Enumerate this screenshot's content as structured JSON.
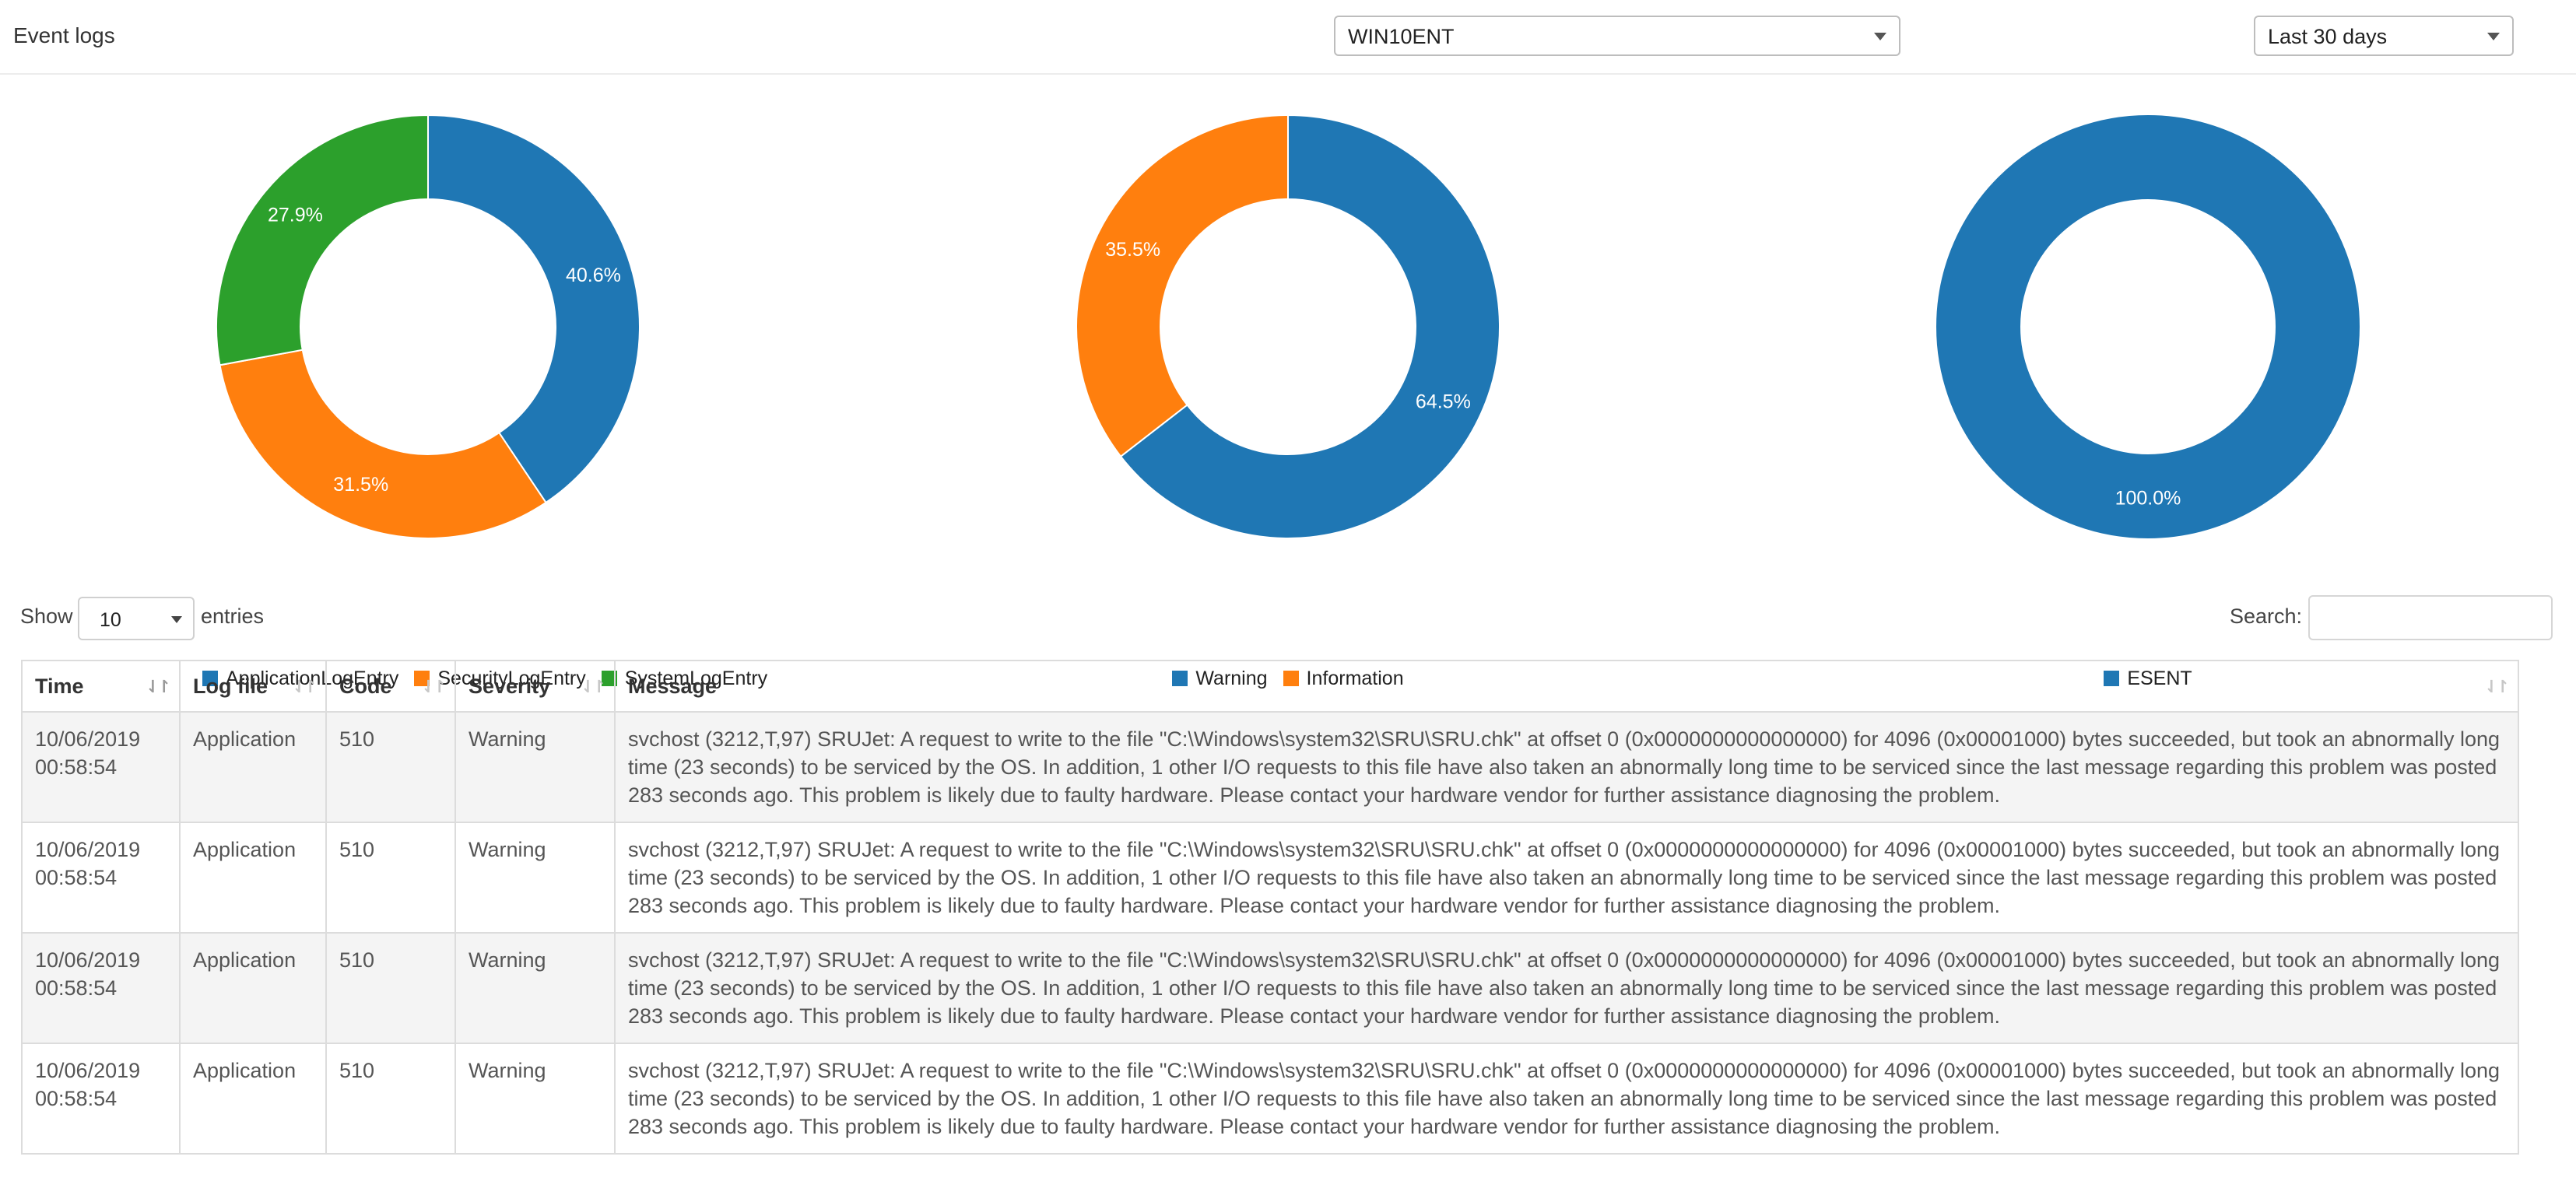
{
  "header": {
    "title": "Event logs",
    "host_select": "WIN10ENT",
    "range_select": "Last 30 days"
  },
  "colors": {
    "blue": "#1f77b4",
    "orange": "#ff7f0e",
    "green": "#2ca02c"
  },
  "chart_data": [
    {
      "type": "pie",
      "donut": true,
      "slices": [
        {
          "name": "ApplicationLogEntry",
          "value": 40.6,
          "label": "40.6%",
          "color": "#1f77b4"
        },
        {
          "name": "SecurityLogEntry",
          "value": 31.5,
          "label": "31.5%",
          "color": "#ff7f0e"
        },
        {
          "name": "SystemLogEntry",
          "value": 27.9,
          "label": "27.9%",
          "color": "#2ca02c"
        }
      ],
      "legend_position": "bottom"
    },
    {
      "type": "pie",
      "donut": true,
      "slices": [
        {
          "name": "Warning",
          "value": 64.5,
          "label": "64.5%",
          "color": "#1f77b4"
        },
        {
          "name": "Information",
          "value": 35.5,
          "label": "35.5%",
          "color": "#ff7f0e"
        }
      ],
      "legend_position": "bottom"
    },
    {
      "type": "pie",
      "donut": true,
      "slices": [
        {
          "name": "ESENT",
          "value": 100.0,
          "label": "100.0%",
          "color": "#1f77b4"
        }
      ],
      "legend_position": "bottom"
    }
  ],
  "table_controls": {
    "show_label": "Show",
    "length_value": "10",
    "entries_label": "entries",
    "search_label": "Search:",
    "search_value": ""
  },
  "table": {
    "columns": [
      "Time",
      "Log file",
      "Code",
      "Severity",
      "Message"
    ],
    "rows": [
      {
        "time_date": "10/06/2019",
        "time_clock": "00:58:54",
        "log_file": "Application",
        "code": "510",
        "severity": "Warning",
        "message": "svchost (3212,T,97) SRUJet: A request to write to the file \"C:\\Windows\\system32\\SRU\\SRU.chk\" at offset 0 (0x0000000000000000) for 4096 (0x00001000) bytes succeeded, but took an abnormally long time (23 seconds) to be serviced by the OS. In addition, 1 other I/O requests to this file have also taken an abnormally long time to be serviced since the last message regarding this problem was posted 283 seconds ago. This problem is likely due to faulty hardware. Please contact your hardware vendor for further assistance diagnosing the problem."
      },
      {
        "time_date": "10/06/2019",
        "time_clock": "00:58:54",
        "log_file": "Application",
        "code": "510",
        "severity": "Warning",
        "message": "svchost (3212,T,97) SRUJet: A request to write to the file \"C:\\Windows\\system32\\SRU\\SRU.chk\" at offset 0 (0x0000000000000000) for 4096 (0x00001000) bytes succeeded, but took an abnormally long time (23 seconds) to be serviced by the OS. In addition, 1 other I/O requests to this file have also taken an abnormally long time to be serviced since the last message regarding this problem was posted 283 seconds ago. This problem is likely due to faulty hardware. Please contact your hardware vendor for further assistance diagnosing the problem."
      },
      {
        "time_date": "10/06/2019",
        "time_clock": "00:58:54",
        "log_file": "Application",
        "code": "510",
        "severity": "Warning",
        "message": "svchost (3212,T,97) SRUJet: A request to write to the file \"C:\\Windows\\system32\\SRU\\SRU.chk\" at offset 0 (0x0000000000000000) for 4096 (0x00001000) bytes succeeded, but took an abnormally long time (23 seconds) to be serviced by the OS. In addition, 1 other I/O requests to this file have also taken an abnormally long time to be serviced since the last message regarding this problem was posted 283 seconds ago. This problem is likely due to faulty hardware. Please contact your hardware vendor for further assistance diagnosing the problem."
      },
      {
        "time_date": "10/06/2019",
        "time_clock": "00:58:54",
        "log_file": "Application",
        "code": "510",
        "severity": "Warning",
        "message": "svchost (3212,T,97) SRUJet: A request to write to the file \"C:\\Windows\\system32\\SRU\\SRU.chk\" at offset 0 (0x0000000000000000) for 4096 (0x00001000) bytes succeeded, but took an abnormally long time (23 seconds) to be serviced by the OS. In addition, 1 other I/O requests to this file have also taken an abnormally long time to be serviced since the last message regarding this problem was posted 283 seconds ago. This problem is likely due to faulty hardware. Please contact your hardware vendor for further assistance diagnosing the problem."
      }
    ]
  }
}
